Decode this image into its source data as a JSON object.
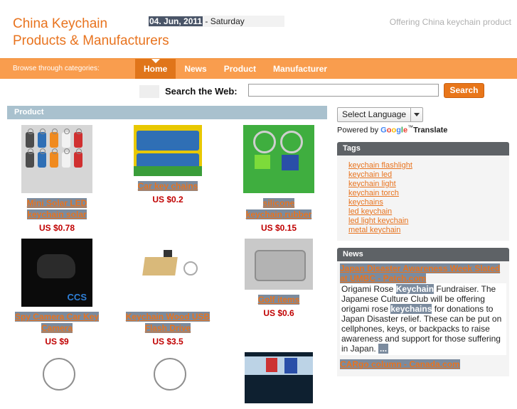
{
  "header": {
    "brand_line1": "China Keychain",
    "brand_line2": "Products & Manufacturers",
    "date_highlight": "04. Jun, 2011",
    "date_rest": " - Saturday",
    "tagline": "Offering China keychain product"
  },
  "nav": {
    "browse_label": "Browse through categories:",
    "items": [
      {
        "label": "Home",
        "active": true
      },
      {
        "label": "News",
        "active": false
      },
      {
        "label": "Product",
        "active": false
      },
      {
        "label": "Manufacturer",
        "active": false
      }
    ]
  },
  "search": {
    "label": "Search the Web:",
    "value": "",
    "placeholder": "",
    "button_label": "Search"
  },
  "translate": {
    "select_label": "Select Language",
    "powered_by": "Powered by",
    "google": "Google",
    "tm": "™",
    "translate_word": "Translate"
  },
  "main": {
    "section_title": "Product",
    "products": [
      {
        "title": "Mini Solar LED keychain solar",
        "price": "US $0.78",
        "thumb": "solar-keychains-photo"
      },
      {
        "title": "Car key chains",
        "price": "US $0.2",
        "thumb": "car-keychain-photo"
      },
      {
        "title": "silicone keychain,rubber",
        "price": "US $0.15",
        "thumb": "silicone-keychain-photo"
      },
      {
        "title": "Spy Camera Car Key Camera",
        "price": "US $9",
        "thumb": "spy-camera-keychain-photo"
      },
      {
        "title": "Keychain Wood USB Flash Drive",
        "price": "US $3.5",
        "thumb": "wood-usb-keychain-photo"
      },
      {
        "title": "Golf items",
        "price": "US $0.6",
        "thumb": "golf-buckle-photo"
      }
    ]
  },
  "sidebar": {
    "tags_title": "Tags",
    "tags": [
      "keychain flashlight",
      "keychain led",
      "keychain light",
      "keychain torch",
      "keychains",
      "led keychain",
      "led light keychain",
      "metal keychain"
    ],
    "news_title": "News",
    "news": [
      {
        "title": "Japan Disaster Awareness Week Slated at UMBC - Patch.com",
        "snippet_parts": [
          {
            "text": "Origami Rose ",
            "highlight": false
          },
          {
            "text": "Keychain",
            "highlight": true
          },
          {
            "text": " Fundraiser. The Japanese Culture Club will be offering origami rose ",
            "highlight": false
          },
          {
            "text": "keychains",
            "highlight": true
          },
          {
            "text": " for donations to Japan Disaster relief. These can be put on cellphones, keys, or backpacks to raise awareness and support for those suffering in Japan. ",
            "highlight": false
          }
        ],
        "ellipsis": "..."
      },
      {
        "title": "CARgo column - Canada.com",
        "snippet_parts": [],
        "ellipsis": ""
      }
    ]
  },
  "colors": {
    "brand_orange": "#E8731E",
    "nav_orange": "#F99D4E",
    "nav_active_orange": "#E0751A",
    "section_blue": "#A9C1CE",
    "panel_gray": "#5E6266",
    "selection_blue": "#7b8b9e",
    "price_red": "#C00000",
    "date_navy": "#4a5568"
  }
}
